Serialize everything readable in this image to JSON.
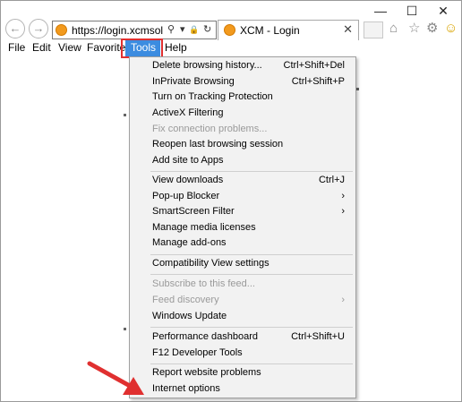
{
  "window": {
    "minimize": "—",
    "maximize": "☐",
    "close": "✕"
  },
  "nav": {
    "back_icon": "back-arrow-icon",
    "forward_icon": "forward-arrow-icon"
  },
  "address": {
    "url": "https://login.xcmsoluti...",
    "search_icon": "⚲",
    "dropdown_icon": "▾",
    "lock_icon": "🔒",
    "refresh_icon": "↻"
  },
  "tab": {
    "title": "XCM - Login",
    "close": "✕"
  },
  "toolbar_icons": {
    "home": "⌂",
    "favorites": "☆",
    "settings": "⚙",
    "feedback": "☺"
  },
  "menubar": {
    "file": "File",
    "edit": "Edit",
    "view": "View",
    "favorites": "Favorites",
    "tools": "Tools",
    "help": "Help"
  },
  "tools_menu": {
    "items": [
      {
        "label": "Delete browsing history...",
        "shortcut": "Ctrl+Shift+Del"
      },
      {
        "label": "InPrivate Browsing",
        "shortcut": "Ctrl+Shift+P"
      },
      {
        "label": "Turn on Tracking Protection",
        "shortcut": ""
      },
      {
        "label": "ActiveX Filtering",
        "shortcut": ""
      },
      {
        "label": "Fix connection problems...",
        "shortcut": ""
      },
      {
        "label": "Reopen last browsing session",
        "shortcut": ""
      },
      {
        "label": "Add site to Apps",
        "shortcut": ""
      },
      {
        "label": "View downloads",
        "shortcut": "Ctrl+J"
      },
      {
        "label": "Pop-up Blocker",
        "shortcut": ""
      },
      {
        "label": "SmartScreen Filter",
        "shortcut": ""
      },
      {
        "label": "Manage media licenses",
        "shortcut": ""
      },
      {
        "label": "Manage add-ons",
        "shortcut": ""
      },
      {
        "label": "Compatibility View settings",
        "shortcut": ""
      },
      {
        "label": "Subscribe to this feed...",
        "shortcut": ""
      },
      {
        "label": "Feed discovery",
        "shortcut": ""
      },
      {
        "label": "Windows Update",
        "shortcut": ""
      },
      {
        "label": "Performance dashboard",
        "shortcut": "Ctrl+Shift+U"
      },
      {
        "label": "F12 Developer Tools",
        "shortcut": ""
      },
      {
        "label": "Report website problems",
        "shortcut": ""
      },
      {
        "label": "Internet options",
        "shortcut": ""
      }
    ],
    "submenu_arrow": "›"
  },
  "colors": {
    "menu_highlight": "#3c8ce0",
    "callout_red": "#e03030",
    "menu_background": "#f2f2f2",
    "disabled_text": "#9a9a9a"
  }
}
